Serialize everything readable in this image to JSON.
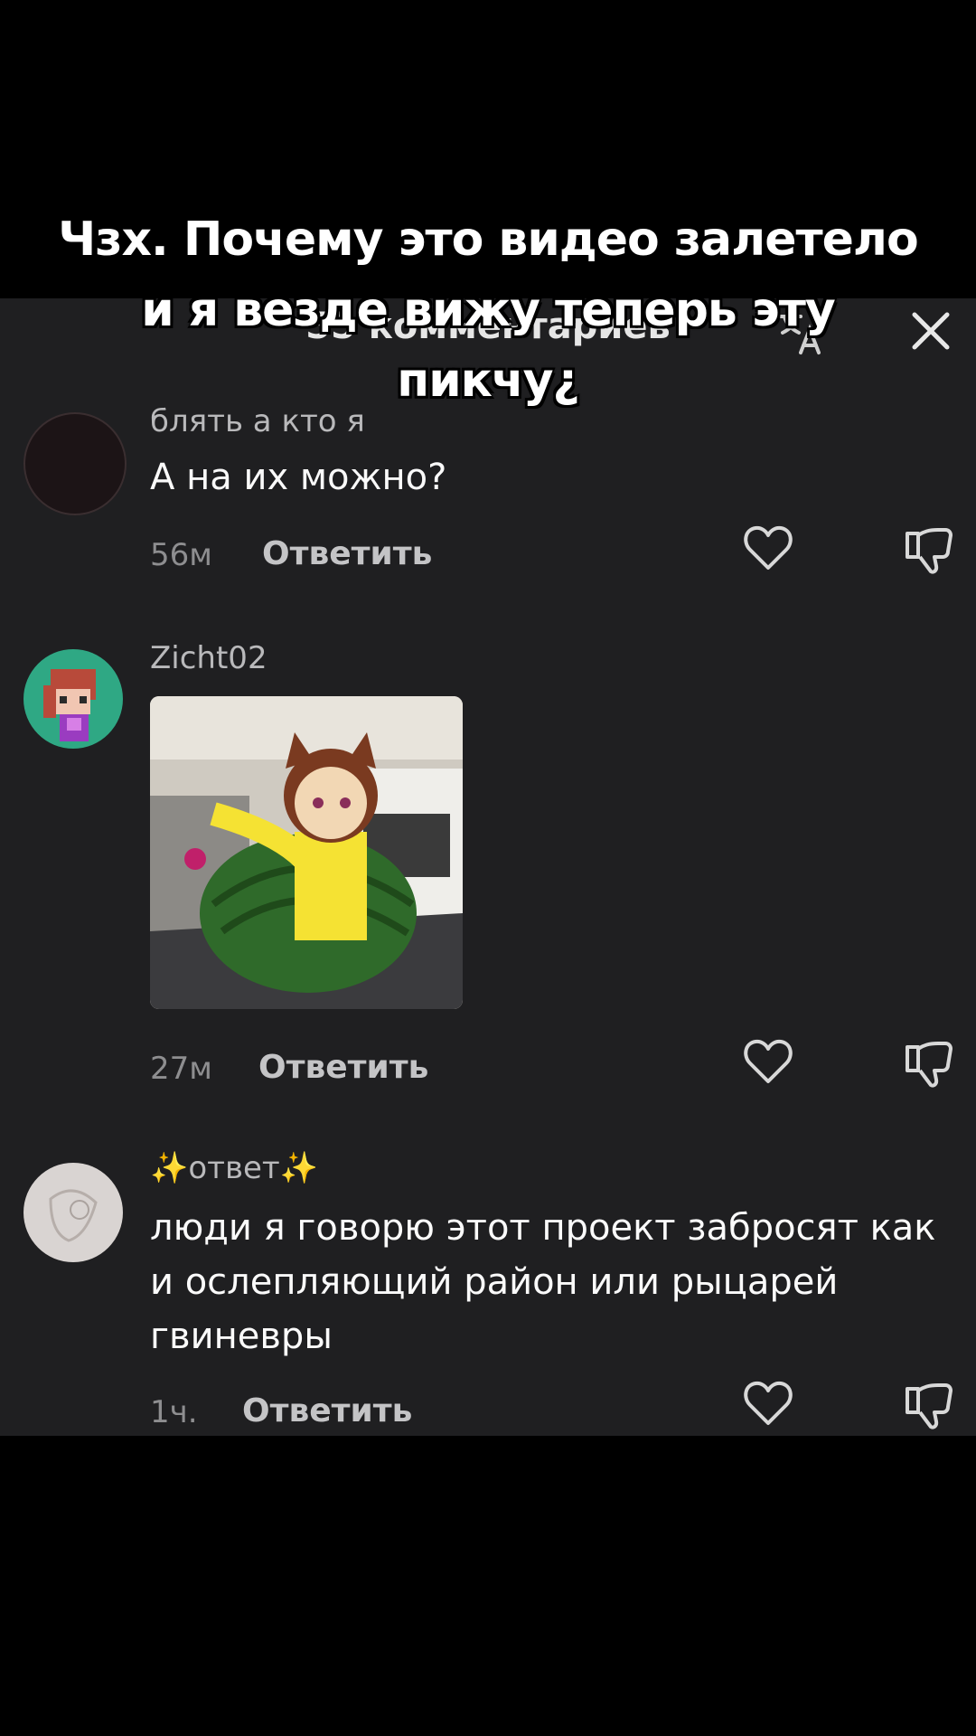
{
  "caption": "Чзх. Почему это видео залетело и я везде вижу теперь эту пикчу¿",
  "header": {
    "title": "55 комментариев",
    "translate_icon": "translate-icon",
    "close_icon": "close-icon"
  },
  "comments": [
    {
      "username": "блять а кто я",
      "text": "А на их можно?",
      "time": "56м",
      "reply_label": "Ответить"
    },
    {
      "username": "Zicht02",
      "image": "cat-girl-on-watermelon-sticker",
      "time": "27м",
      "reply_label": "Ответить"
    },
    {
      "username": "✨ответ✨",
      "text": "люди я говорю этот проект забросят как и ослепляющий район или рыцарей гвиневры",
      "time": "1ч.",
      "reply_label": "Ответить"
    }
  ]
}
